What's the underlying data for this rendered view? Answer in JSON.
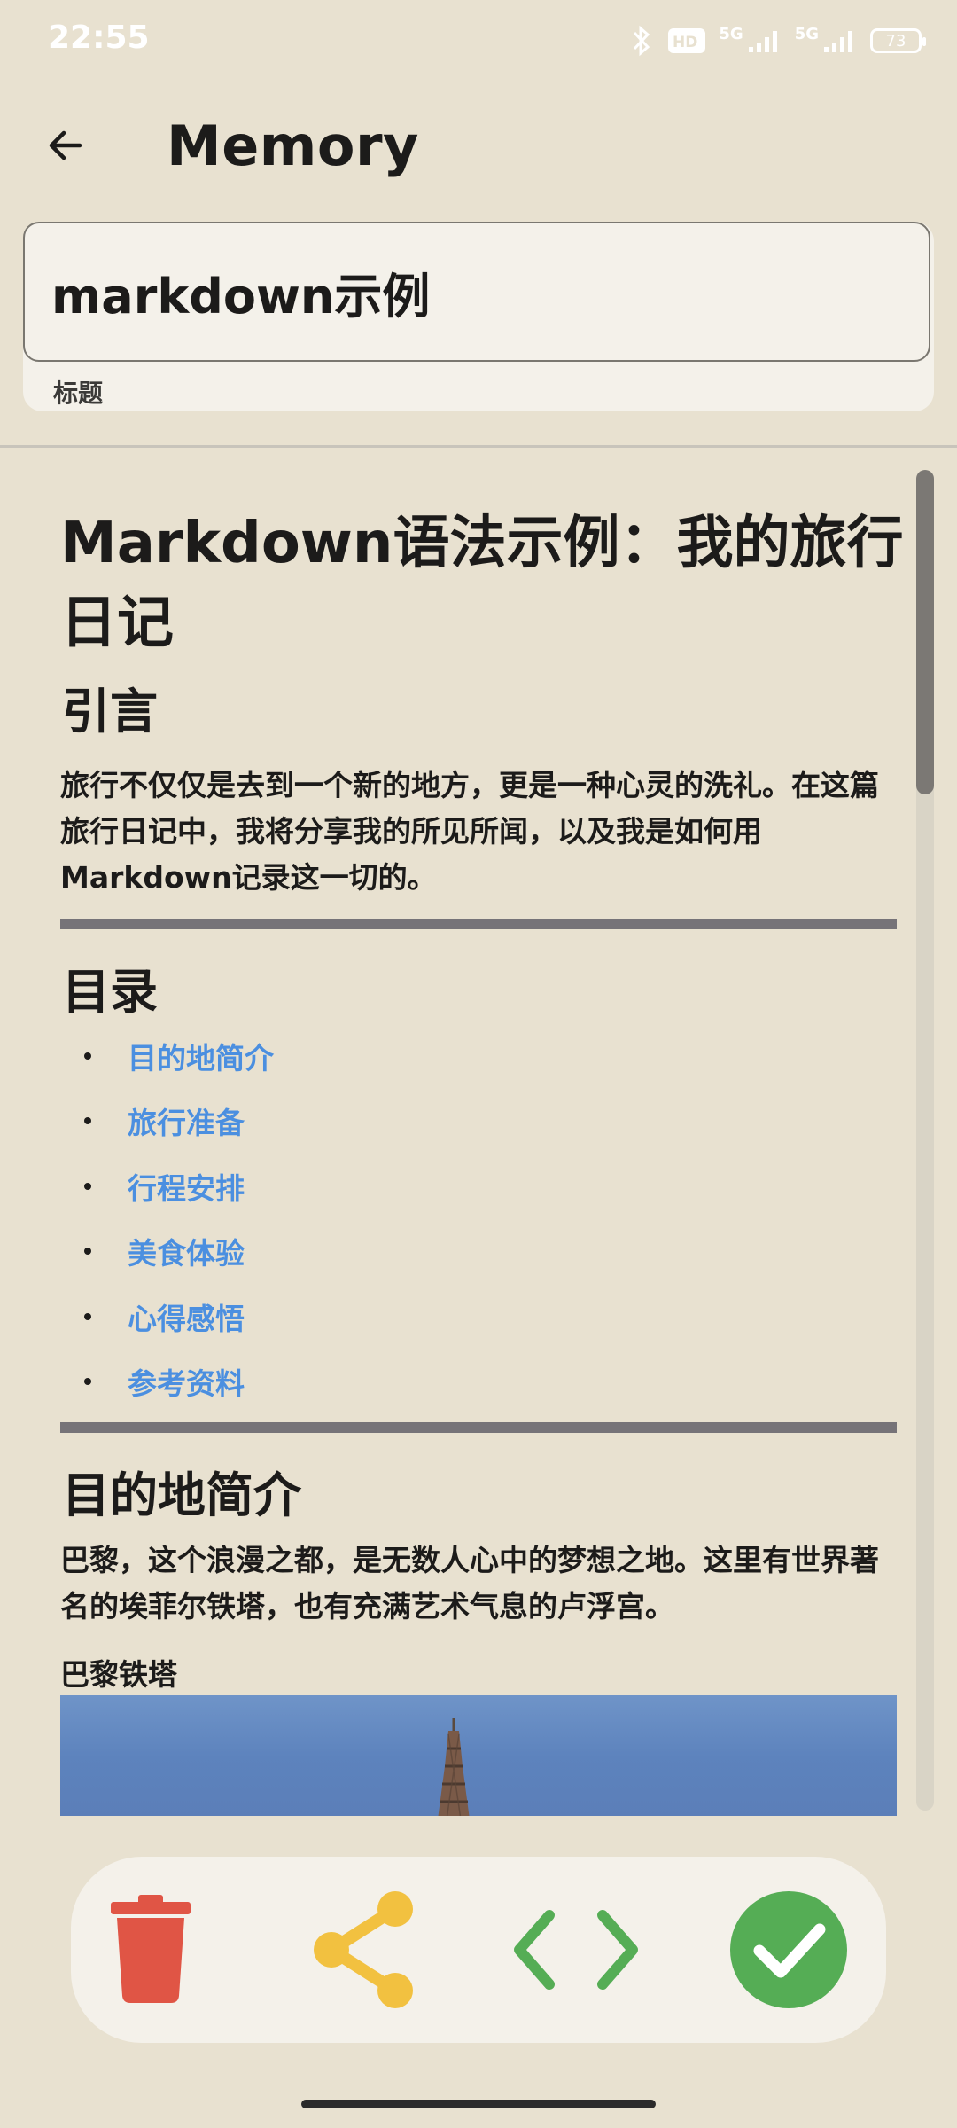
{
  "status_bar": {
    "time": "22:55",
    "network_1": "5G",
    "network_2": "5G",
    "battery": "73",
    "icons": [
      "bluetooth-icon",
      "hd-voice-icon",
      "signal-icon",
      "signal-icon",
      "battery-icon"
    ]
  },
  "app_bar": {
    "back_icon": "arrow-left-icon",
    "title": "Memory"
  },
  "title_field": {
    "value": "markdown示例",
    "label": "标题"
  },
  "document": {
    "h1": "Markdown语法示例：我的旅行日记",
    "intro_heading": "引言",
    "intro_text": "旅行不仅仅是去到一个新的地方，更是一种心灵的洗礼。在这篇旅行日记中，我将分享我的所见所闻，以及我是如何用Markdown记录这一切的。",
    "toc_heading": "目录",
    "toc_items": [
      {
        "label": "目的地简介"
      },
      {
        "label": "旅行准备"
      },
      {
        "label": "行程安排"
      },
      {
        "label": "美食体验"
      },
      {
        "label": "心得感悟"
      },
      {
        "label": "参考资料"
      }
    ],
    "destination_heading": "目的地简介",
    "destination_text": "巴黎，这个浪漫之都，是无数人心中的梦想之地。这里有世界著名的埃菲尔铁塔，也有充满艺术气息的卢浮宫。",
    "image_caption": "巴黎铁塔",
    "link_color": "#4b8fe0"
  },
  "actions": [
    {
      "icon": "trash-icon",
      "color": "#e05545"
    },
    {
      "icon": "share-icon",
      "color": "#f2c140"
    },
    {
      "icon": "code-icon",
      "color": "#55ad55"
    },
    {
      "icon": "check-circle-icon",
      "color": "#55ad55"
    }
  ]
}
